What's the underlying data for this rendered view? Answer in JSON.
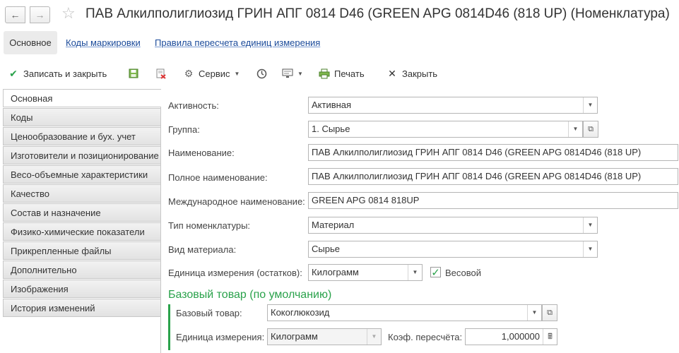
{
  "header": {
    "title": "ПАВ Алкилполиглиозид ГРИН АПГ 0814 D46 (GREEN APG 0814D46 (818 UP) (Номенклатура)"
  },
  "top_tabs": {
    "main": "Основное",
    "codes": "Коды маркировки",
    "rules": "Правила пересчета единиц измерения"
  },
  "toolbar": {
    "save_close": "Записать и закрыть",
    "service": "Сервис",
    "print": "Печать",
    "close": "Закрыть"
  },
  "left_tabs": [
    "Основная",
    "Коды",
    "Ценообразование и бух. учет",
    "Изготовители и позиционирование",
    "Весо-объемные характеристики",
    "Качество",
    "Состав и назначение",
    "Физико-химические показатели",
    "Прикрепленные файлы",
    "Дополнительно",
    "Изображения",
    "История изменений"
  ],
  "form": {
    "activity_label": "Активность:",
    "activity_value": "Активная",
    "group_label": "Группа:",
    "group_value": "1. Сырье",
    "name_label": "Наименование:",
    "name_value": "ПАВ Алкилполиглиозид ГРИН АПГ 0814 D46 (GREEN APG 0814D46 (818 UP)",
    "fullname_label": "Полное наименование:",
    "fullname_value": "ПАВ Алкилполиглиозид ГРИН АПГ 0814 D46 (GREEN APG 0814D46 (818 UP)",
    "intl_label": "Международное наименование:",
    "intl_value": "GREEN APG 0814 818UP",
    "type_label": "Тип номенклатуры:",
    "type_value": "Материал",
    "material_label": "Вид материала:",
    "material_value": "Сырье",
    "unit_label": "Единица измерения (остатков):",
    "unit_value": "Килограмм",
    "weight_label": "Весовой",
    "base_section": "Базовый товар (по умолчанию)",
    "base_label": "Базовый товар:",
    "base_value": "Кокоглюкозид",
    "base_unit_label": "Единица измерения:",
    "base_unit_value": "Килограмм",
    "coef_label": "Коэф. пересчёта:",
    "coef_value": "1,000000"
  }
}
